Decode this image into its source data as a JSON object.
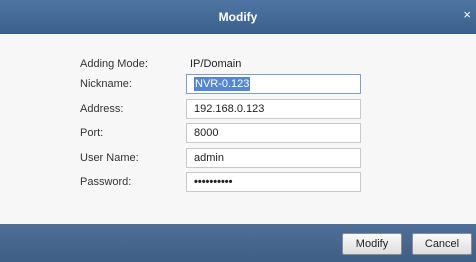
{
  "dialog": {
    "title": "Modify",
    "close_glyph": "×"
  },
  "form": {
    "adding_mode": {
      "label": "Adding Mode:",
      "value": "IP/Domain"
    },
    "nickname": {
      "label": "Nickname:",
      "value": "NVR-0.123"
    },
    "address": {
      "label": "Address:",
      "value": "192.168.0.123"
    },
    "port": {
      "label": "Port:",
      "value": "8000"
    },
    "user_name": {
      "label": "User Name:",
      "value": "admin"
    },
    "password": {
      "label": "Password:",
      "value": "••••••••••"
    }
  },
  "buttons": {
    "modify": "Modify",
    "cancel": "Cancel"
  },
  "colors": {
    "titlebar": "#4a6f9c",
    "selection": "#5585d5"
  }
}
